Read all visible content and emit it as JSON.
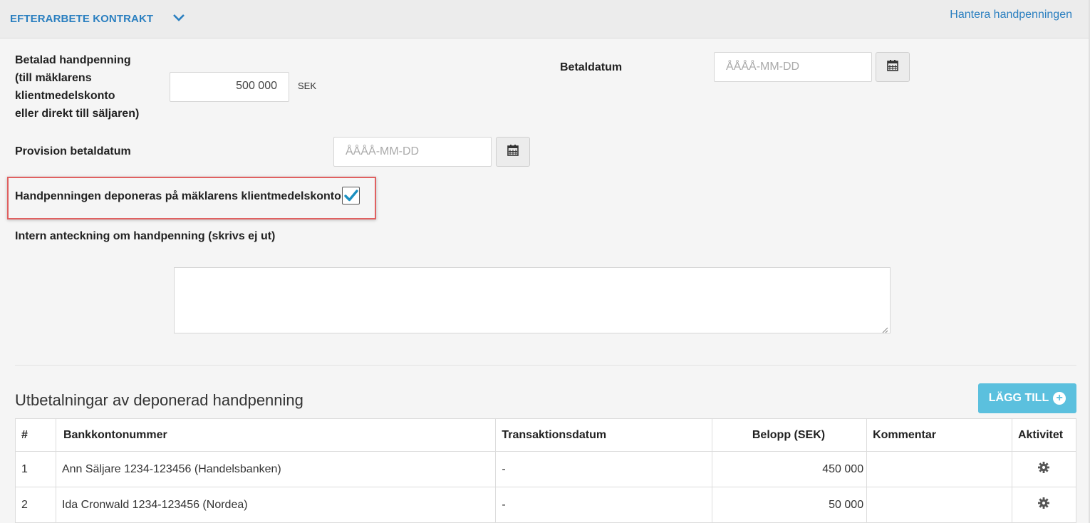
{
  "header": {
    "title": "EFTERARBETE KONTRAKT",
    "link": "Hantera handpenningen"
  },
  "form": {
    "paid_deposit_label_lines": [
      "Betalad handpenning",
      "(till mäklarens",
      "klientmedelskonto",
      "eller direkt till säljaren)"
    ],
    "paid_deposit_value": "500 000",
    "currency": "SEK",
    "pay_date_label": "Betaldatum",
    "pay_date_placeholder": "ÅÅÅÅ-MM-DD",
    "commission_date_label": "Provision betaldatum",
    "commission_date_placeholder": "ÅÅÅÅ-MM-DD",
    "deposit_checkbox_label": "Handpenningen deponeras på mäklarens klientmedelskonto",
    "deposit_checkbox_checked": true,
    "internal_note_label": "Intern anteckning om handpenning (skrivs ej ut)",
    "internal_note_value": ""
  },
  "payouts": {
    "title": "Utbetalningar av deponerad handpenning",
    "add_button": "LÄGG TILL",
    "columns": [
      "#",
      "Bankkontonummer",
      "Transaktionsdatum",
      "Belopp (SEK)",
      "Kommentar",
      "Aktivitet"
    ],
    "rows": [
      {
        "num": "1",
        "account": "Ann Säljare 1234-123456 (Handelsbanken)",
        "date": "-",
        "amount": "450 000",
        "comment": ""
      },
      {
        "num": "2",
        "account": "Ida Cronwald 1234-123456 (Nordea)",
        "date": "-",
        "amount": "50 000",
        "comment": ""
      }
    ]
  },
  "colors": {
    "link": "#2a7fc0",
    "accent_button": "#5bc0de",
    "check": "#1a8fc0",
    "highlight_border": "#e06060"
  }
}
